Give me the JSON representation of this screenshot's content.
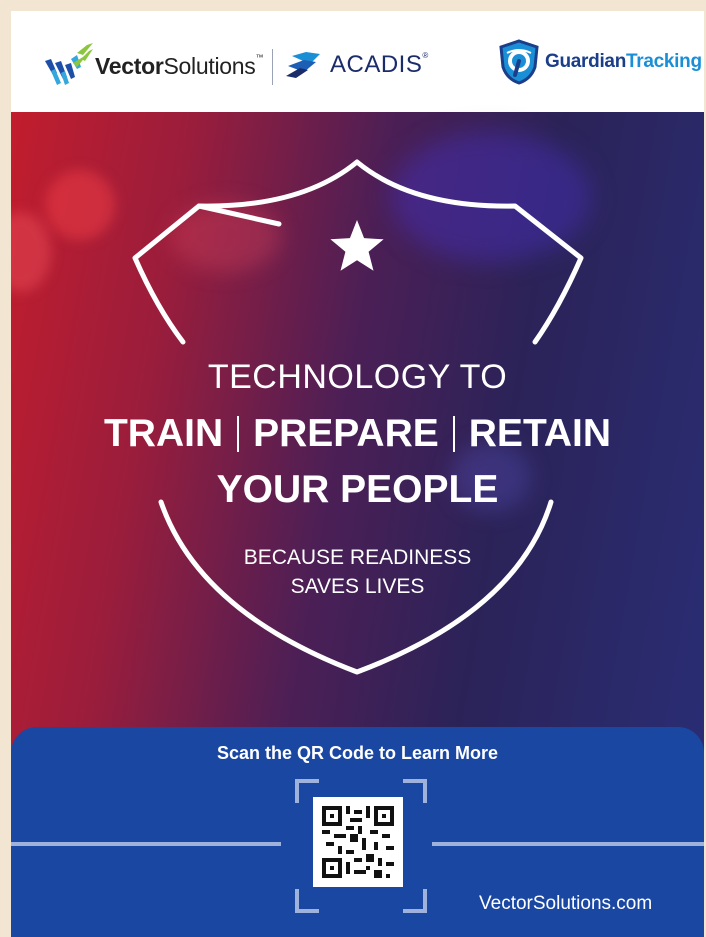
{
  "header": {
    "brand1_bold": "Vector",
    "brand1_light": "Solutions",
    "brand1_mark": "™",
    "brand2": "ACADIS",
    "brand2_mark": "®",
    "brand3_a": "Guardian",
    "brand3_b": "Tracking"
  },
  "hero": {
    "line1": "TECHNOLOGY TO",
    "word_train": "TRAIN",
    "word_prepare": "PREPARE",
    "word_retain": "RETAIN",
    "line3": "YOUR PEOPLE",
    "tag1": "BECAUSE READINESS",
    "tag2": "SAVES LIVES"
  },
  "panel": {
    "title": "Scan the QR Code to Learn More",
    "website": "VectorSolutions.com"
  },
  "icons": {
    "shield": "shield-outline-icon",
    "star": "star-icon",
    "qr": "qr-code-icon"
  },
  "colors": {
    "panel_blue": "#1a47a2",
    "acadis_navy": "#1b2c6b",
    "tracking_blue": "#1b8fd6",
    "hero_red": "#c21d2d",
    "hero_indigo": "#2a2e78"
  }
}
